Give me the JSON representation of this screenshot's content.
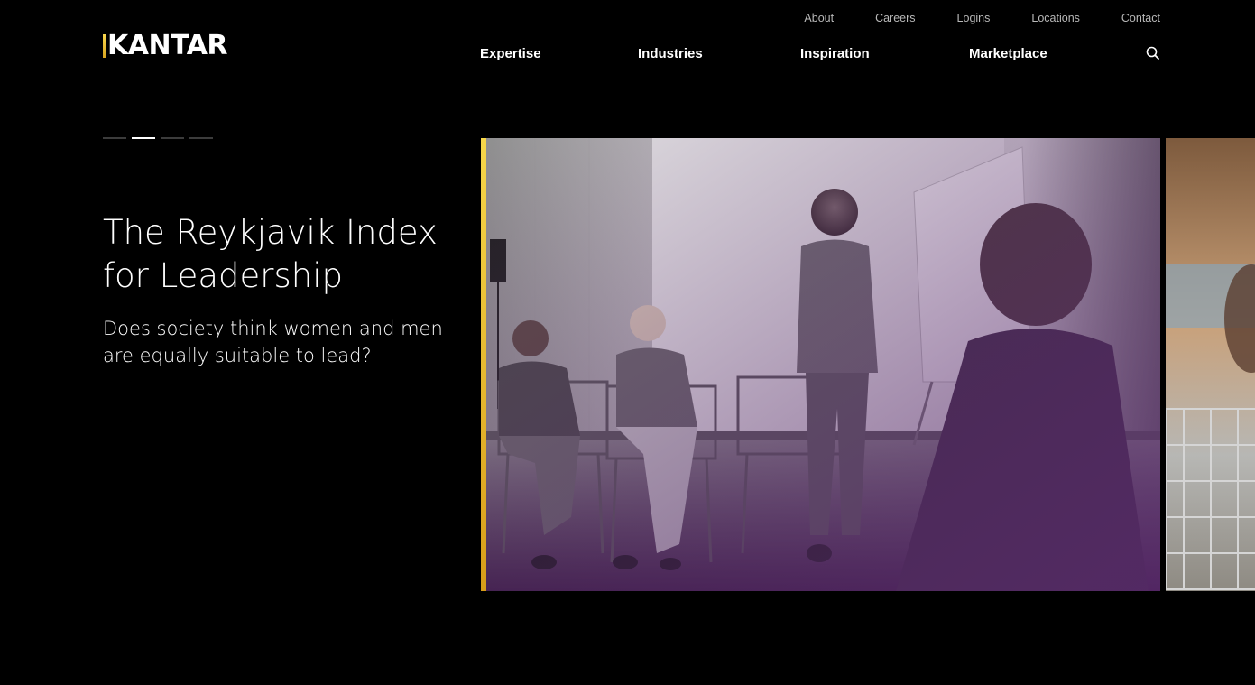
{
  "brand": {
    "logo_text": "KANTAR",
    "accent_color": "#f2c230"
  },
  "utility_nav": [
    "About",
    "Careers",
    "Logins",
    "Locations",
    "Contact"
  ],
  "main_nav": [
    "Expertise",
    "Industries",
    "Inspiration",
    "Marketplace"
  ],
  "search": {
    "icon": "search-icon"
  },
  "carousel": {
    "slide_count": 4,
    "active_index": 1
  },
  "hero": {
    "title_line1": "The Reykjavik Index",
    "title_line2": "for Leadership",
    "subtitle_line1": "Does society think women and men",
    "subtitle_line2": "are equally suitable to lead?"
  },
  "colors": {
    "background": "#000000",
    "text": "#ffffff",
    "utility_text": "#b8b8b8",
    "image_tint": "#5a2a6a"
  }
}
